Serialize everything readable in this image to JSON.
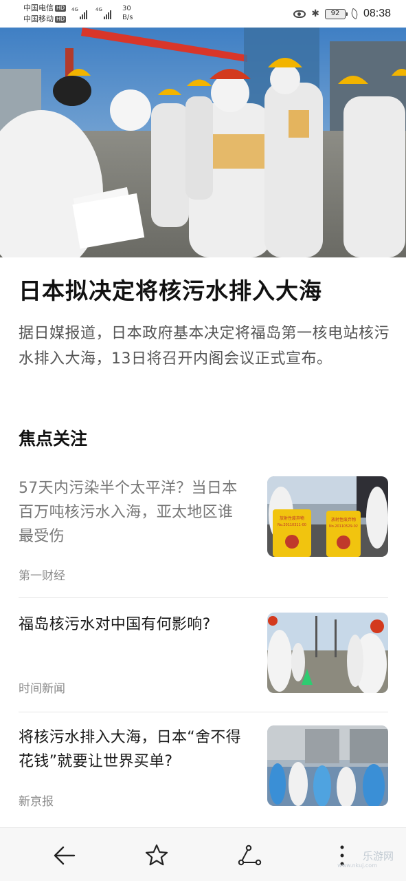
{
  "status_bar": {
    "carrier_1": "中国电信",
    "carrier_2": "中国移动",
    "hd_badge": "HD",
    "network_label": "4G",
    "speed_value": "30",
    "speed_unit": "B/s",
    "battery": "92",
    "time": "08:38",
    "icons": [
      "eye-icon",
      "bluetooth-icon",
      "battery-icon",
      "leaf-icon"
    ]
  },
  "article": {
    "headline": "日本拟决定将核污水排入大海",
    "summary": "据日媒报道，日本政府基本决定将福岛第一核电站核污水排入大海，13日将召开内阁会议正式宣布。"
  },
  "focus": {
    "title": "焦点关注",
    "items": [
      {
        "title": "57天内污染半个太平洋？当日本百万吨核污水入海，亚太地区谁最受伤",
        "source": "第一财经",
        "read": true
      },
      {
        "title": "福岛核污水对中国有何影响?",
        "source": "时间新闻",
        "read": false
      },
      {
        "title": "将核污水排入大海，日本“舍不得花钱”就要让世界买单?",
        "source": "新京报",
        "read": false
      }
    ]
  },
  "thumb_text": {
    "barrel_label": "放射性废弃物",
    "barrel_code_1": "No.20110311-00",
    "barrel_code_2": "No.20110529-02"
  },
  "bottom_bar": {
    "icons": [
      "back-arrow-icon",
      "star-icon",
      "share-icon",
      "more-vertical-icon"
    ],
    "watermark": "乐游网",
    "watermark_url": "www.nkuj.com"
  },
  "colors": {
    "headline": "#111111",
    "summary": "#555555",
    "source": "#8a8a8a",
    "hazmat_white": "#f0f0f0",
    "helmet_yellow": "#f2b400",
    "helmet_red": "#d33a1e",
    "barrel_yellow": "#f1c40f"
  }
}
